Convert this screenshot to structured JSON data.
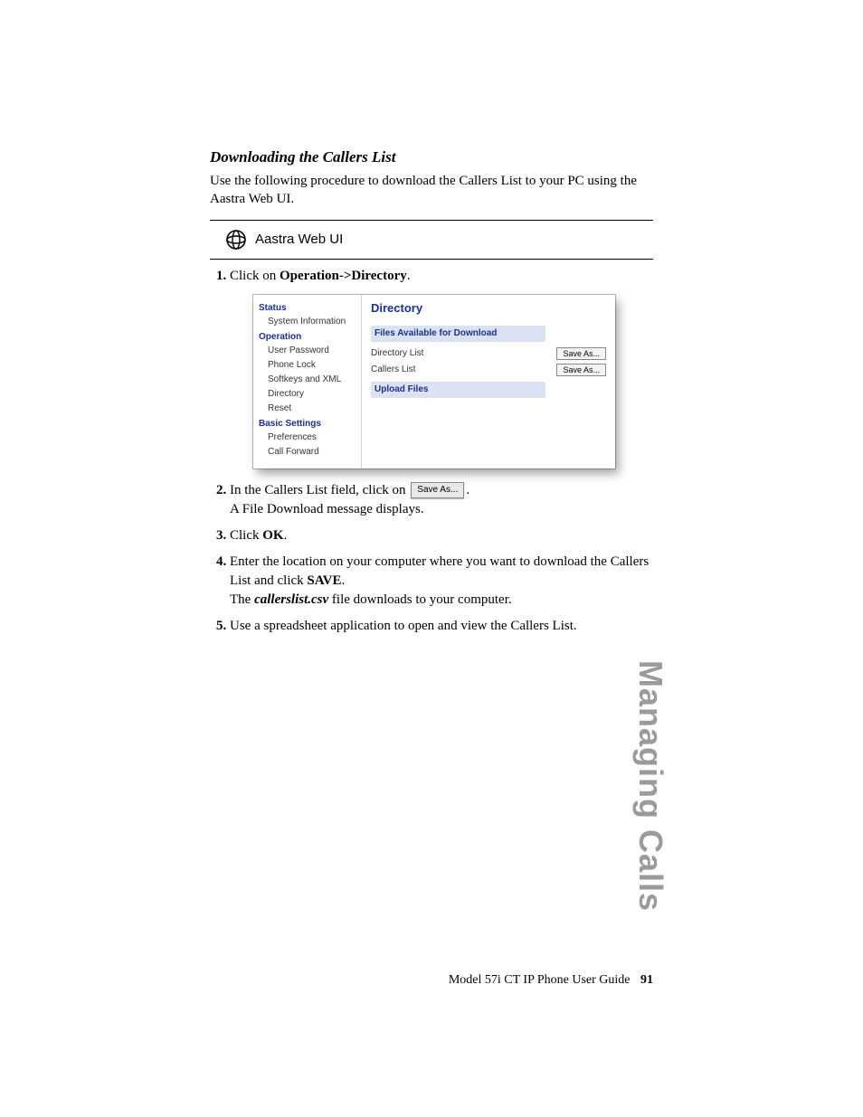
{
  "heading": "Downloading the Callers List",
  "intro": "Use the following procedure to download the Callers List to your PC using the Aastra Web UI.",
  "aastra_label": "Aastra Web UI",
  "steps": {
    "s1_a": "Click on ",
    "s1_b": "Operation->Directory",
    "s1_c": ".",
    "s2_a": "In the Callers List field, click on ",
    "s2_btn": "Save As...",
    "s2_b": ".",
    "s2_line2": "A File Download message displays.",
    "s3_a": "Click ",
    "s3_b": "OK",
    "s3_c": ".",
    "s4_a": "Enter the location on your computer where you want to download the Callers List and click ",
    "s4_b": "SAVE",
    "s4_c": ".",
    "s4_line2_a": "The ",
    "s4_line2_b": "callerslist.csv",
    "s4_line2_c": " file downloads to your computer.",
    "s5": "Use a spreadsheet application to open and view the Callers List."
  },
  "ui": {
    "side": {
      "g1": "Status",
      "g1_items": [
        "System Information"
      ],
      "g2": "Operation",
      "g2_items": [
        "User Password",
        "Phone Lock",
        "Softkeys and XML",
        "Directory",
        "Reset"
      ],
      "g3": "Basic Settings",
      "g3_items": [
        "Preferences",
        "Call Forward"
      ]
    },
    "title": "Directory",
    "sub1": "Files Available for Download",
    "row1_label": "Directory List",
    "row1_btn": "Save As...",
    "row2_label": "Callers List",
    "row2_btn": "Save As...",
    "sub2": "Upload Files"
  },
  "chapter": "Managing Calls",
  "footer_text": "Model 57i CT IP Phone User Guide",
  "footer_page": "91"
}
